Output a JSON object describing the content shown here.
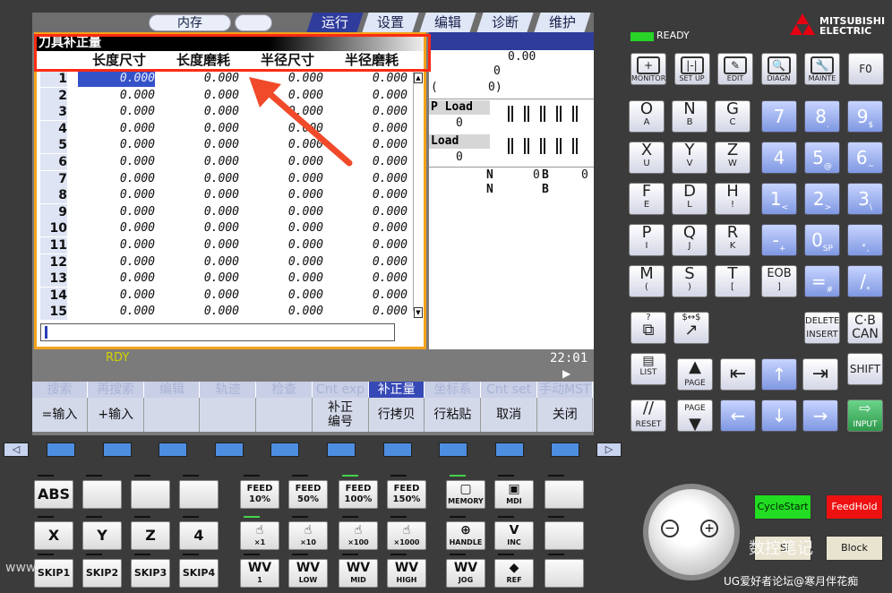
{
  "top_tabs": {
    "memory": "内存",
    "run": "运行",
    "setup": "设置",
    "edit": "编辑",
    "diagnose": "诊断",
    "maintain": "维护"
  },
  "panel": {
    "title": "刀具补正量",
    "columns": [
      "长度尺寸",
      "长度磨耗",
      "半径尺寸",
      "半径磨耗"
    ],
    "rows": [
      {
        "n": "1",
        "v": [
          "0.000",
          "0.000",
          "0.000",
          "0.000"
        ]
      },
      {
        "n": "2",
        "v": [
          "0.000",
          "0.000",
          "0.000",
          "0.000"
        ]
      },
      {
        "n": "3",
        "v": [
          "0.000",
          "0.000",
          "0.000",
          "0.000"
        ]
      },
      {
        "n": "4",
        "v": [
          "0.000",
          "0.000",
          "0.000",
          "0.000"
        ]
      },
      {
        "n": "5",
        "v": [
          "0.000",
          "0.000",
          "0.000",
          "0.000"
        ]
      },
      {
        "n": "6",
        "v": [
          "0.000",
          "0.000",
          "0.000",
          "0.000"
        ]
      },
      {
        "n": "7",
        "v": [
          "0.000",
          "0.000",
          "0.000",
          "0.000"
        ]
      },
      {
        "n": "8",
        "v": [
          "0.000",
          "0.000",
          "0.000",
          "0.000"
        ]
      },
      {
        "n": "9",
        "v": [
          "0.000",
          "0.000",
          "0.000",
          "0.000"
        ]
      },
      {
        "n": "10",
        "v": [
          "0.000",
          "0.000",
          "0.000",
          "0.000"
        ]
      },
      {
        "n": "11",
        "v": [
          "0.000",
          "0.000",
          "0.000",
          "0.000"
        ]
      },
      {
        "n": "12",
        "v": [
          "0.000",
          "0.000",
          "0.000",
          "0.000"
        ]
      },
      {
        "n": "13",
        "v": [
          "0.000",
          "0.000",
          "0.000",
          "0.000"
        ]
      },
      {
        "n": "14",
        "v": [
          "0.000",
          "0.000",
          "0.000",
          "0.000"
        ]
      },
      {
        "n": "15",
        "v": [
          "0.000",
          "0.000",
          "0.000",
          "0.000"
        ]
      }
    ]
  },
  "right_info": {
    "val1": "0.00",
    "val2": "0",
    "val3": "(",
    "val4": "0)",
    "pload": "P Load",
    "pload_val": "0",
    "load": "Load",
    "load_val": "0",
    "n1": "N",
    "zero1": "0",
    "b1": "B",
    "zero2": "0",
    "n2": "N",
    "b2": "B"
  },
  "status": {
    "rdy": "RDY",
    "time": "22:01"
  },
  "menu_top": [
    "搜索",
    "再搜索",
    "编辑",
    "轨迹",
    "检查",
    "Cnt exp",
    "补正量",
    "坐标系",
    "Cnt set",
    "手动MST"
  ],
  "menu_bottom": [
    "=输入",
    "+输入",
    "",
    "",
    "",
    "补正\n编号",
    "行拷贝",
    "行粘贴",
    "取消",
    "关闭"
  ],
  "indicator": {
    "ready": "READY"
  },
  "brand": {
    "line1": "MITSUBISHI",
    "line2": "ELECTRIC"
  },
  "fn_keys": [
    {
      "icon": "+",
      "label": "MONITOR"
    },
    {
      "icon": "|-|",
      "label": "SET UP"
    },
    {
      "icon": "✎",
      "label": "EDIT"
    },
    {
      "icon": "🔍",
      "label": "DIAGN"
    },
    {
      "icon": "🔧",
      "label": "MAINTE"
    },
    {
      "icon": "",
      "label": "F0"
    }
  ],
  "alpha_keys": [
    [
      "O",
      "A"
    ],
    [
      "N",
      "B"
    ],
    [
      "G",
      "C"
    ],
    [
      "X",
      "U"
    ],
    [
      "Y",
      "V"
    ],
    [
      "Z",
      "W"
    ],
    [
      "F",
      "E"
    ],
    [
      "D",
      "L"
    ],
    [
      "H",
      "!"
    ],
    [
      "P",
      "I"
    ],
    [
      "Q",
      "J"
    ],
    [
      "R",
      "K"
    ],
    [
      "M",
      "("
    ],
    [
      "S",
      ")"
    ],
    [
      "T",
      "["
    ]
  ],
  "num_keys": [
    [
      "7",
      ""
    ],
    [
      "8",
      "."
    ],
    [
      "9",
      "$"
    ],
    [
      "4",
      ""
    ],
    [
      "5",
      "@"
    ],
    [
      "6",
      "~"
    ],
    [
      "1",
      "<"
    ],
    [
      "2",
      ">"
    ],
    [
      "3",
      "\\"
    ],
    [
      "-",
      "+"
    ],
    [
      "0",
      "SP"
    ],
    [
      ".",
      ","
    ],
    [
      "EOB",
      "]"
    ],
    [
      "=",
      "#"
    ],
    [
      "/",
      "*"
    ]
  ],
  "edit_keys": {
    "delete": "DELETE",
    "insert": "INSERT",
    "cb": "C·B",
    "can": "CAN",
    "shift": "SHIFT",
    "list": "LIST",
    "page": "PAGE",
    "reset": "RESET",
    "input": "INPUT"
  },
  "machine_row1": [
    "ABS",
    "",
    "",
    "",
    "FEED\n10%",
    "FEED\n50%",
    "FEED\n100%",
    "FEED\n150%",
    "MEMORY",
    "MDI",
    ""
  ],
  "machine_row2": [
    "X",
    "Y",
    "Z",
    "4",
    "×1",
    "×10",
    "×100",
    "×1000",
    "HANDLE",
    "INC",
    ""
  ],
  "machine_row3": [
    "SKIP1",
    "SKIP2",
    "SKIP3",
    "SKIP4",
    "1",
    "LOW",
    "MID",
    "HIGH",
    "JOG",
    "REF",
    ""
  ],
  "controls": {
    "cycle_start": "CycleStart",
    "feed_hold": "FeedHold",
    "block": "Block",
    "single_prefix": "Si"
  },
  "watermarks": {
    "left": "www.",
    "wechat": "数控笔记",
    "forum": "UG爱好者论坛@寒月伴花痴"
  },
  "colors": {
    "accent_orange": "#f2a21b",
    "highlight_red": "#ff2a12",
    "brand_red": "#e60012",
    "cycle_green": "#22dd22",
    "hold_red": "#ee1111"
  }
}
